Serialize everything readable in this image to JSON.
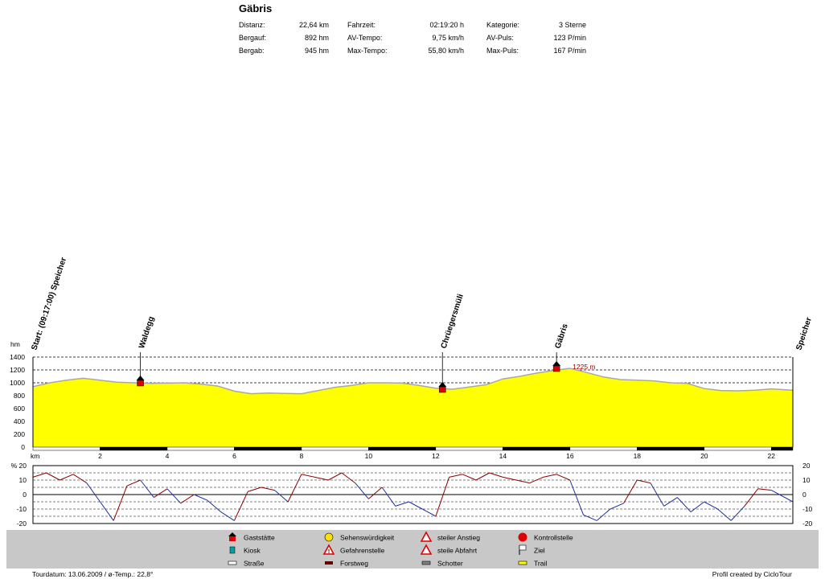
{
  "title": "Gäbris",
  "stats": {
    "col1": [
      {
        "label": "Distanz:",
        "value": "22,64 km"
      },
      {
        "label": "Bergauf:",
        "value": "892 hm"
      },
      {
        "label": "Bergab:",
        "value": "945 hm"
      }
    ],
    "col2": [
      {
        "label": "Fahrzeit:",
        "value": "02:19:20 h"
      },
      {
        "label": "AV-Tempo:",
        "value": "9,75 km/h"
      },
      {
        "label": "Max-Tempo:",
        "value": "55,80 km/h"
      }
    ],
    "col3": [
      {
        "label": "Kategorie:",
        "value": "3 Sterne"
      },
      {
        "label": "AV-Puls:",
        "value": "123 P/min"
      },
      {
        "label": "Max-Puls:",
        "value": "167 P/min"
      }
    ]
  },
  "chart_data": [
    {
      "type": "area",
      "ylabel": "hm",
      "xlabel": "km",
      "xlim": [
        0,
        22.64
      ],
      "ylim": [
        0,
        1400
      ],
      "yticks": [
        0,
        200,
        400,
        600,
        800,
        1000,
        1200,
        1400
      ],
      "xticks": [
        2,
        4,
        6,
        8,
        10,
        12,
        14,
        16,
        18,
        20,
        22
      ],
      "grid": "horizontal dashed",
      "fill_color": "#ffff00",
      "line_color": "#a8a8a8",
      "x": [
        0,
        0.5,
        1,
        1.5,
        2,
        2.5,
        3,
        3.5,
        4,
        4.5,
        5,
        5.5,
        6,
        6.5,
        7,
        7.5,
        8,
        8.5,
        9,
        9.5,
        10,
        10.5,
        11,
        11.5,
        12,
        12.5,
        13,
        13.5,
        14,
        14.5,
        15,
        15.5,
        16,
        16.5,
        17,
        17.5,
        18,
        18.5,
        19,
        19.5,
        20,
        20.5,
        21,
        21.5,
        22,
        22.64
      ],
      "y": [
        940,
        1000,
        1040,
        1070,
        1040,
        1010,
        1000,
        990,
        995,
        1000,
        980,
        950,
        870,
        830,
        840,
        835,
        830,
        880,
        930,
        960,
        1000,
        1000,
        995,
        960,
        915,
        900,
        935,
        970,
        1060,
        1100,
        1150,
        1190,
        1225,
        1160,
        1090,
        1050,
        1040,
        1030,
        1000,
        990,
        910,
        880,
        875,
        885,
        905,
        885
      ],
      "points": [
        {
          "label": "Start: (09:17:00) Speicher",
          "x": 0
        },
        {
          "label": "Waldegg",
          "x": 3.2,
          "elevation": 1000,
          "marker": "Gaststätte"
        },
        {
          "label": "Chrüegersmüli",
          "x": 12.2,
          "elevation": 900,
          "marker": "Gaststätte"
        },
        {
          "label": "Gäbris",
          "x": 15.6,
          "elevation": 1225,
          "marker": "Gaststätte",
          "annotation": "1225 m"
        },
        {
          "label": "Speicher",
          "x": 22.64
        }
      ]
    },
    {
      "type": "line",
      "ylabel": "%",
      "ylim": [
        -20,
        20
      ],
      "yticks": [
        -20,
        -10,
        0,
        10,
        20
      ],
      "grid": "horizontal dashed",
      "series": [
        {
          "color_up": "#8b0000",
          "color_down": "#2030a0",
          "x": [
            0,
            0.4,
            0.8,
            1.2,
            1.6,
            2.0,
            2.4,
            2.8,
            3.2,
            3.6,
            4.0,
            4.4,
            4.8,
            5.2,
            5.6,
            6.0,
            6.4,
            6.8,
            7.2,
            7.6,
            8.0,
            8.4,
            8.8,
            9.2,
            9.6,
            10.0,
            10.4,
            10.8,
            11.2,
            11.6,
            12.0,
            12.4,
            12.8,
            13.2,
            13.6,
            14.0,
            14.4,
            14.8,
            15.2,
            15.6,
            16.0,
            16.4,
            16.8,
            17.2,
            17.6,
            18.0,
            18.4,
            18.8,
            19.2,
            19.6,
            20.0,
            20.4,
            20.8,
            21.2,
            21.6,
            22.0,
            22.64
          ],
          "y": [
            12,
            15,
            10,
            14,
            8,
            -5,
            -18,
            6,
            10,
            -2,
            4,
            -6,
            0,
            -4,
            -12,
            -18,
            2,
            5,
            3,
            -5,
            14,
            12,
            10,
            15,
            8,
            -3,
            5,
            -8,
            -5,
            -10,
            -15,
            12,
            14,
            10,
            15,
            12,
            10,
            8,
            12,
            14,
            10,
            -14,
            -18,
            -10,
            -6,
            10,
            8,
            -8,
            -2,
            -12,
            -5,
            -10,
            -18,
            -8,
            4,
            3,
            -5
          ]
        }
      ]
    }
  ],
  "legend": [
    {
      "label": "Gaststätte",
      "icon": "gaststaette-icon"
    },
    {
      "label": "Kiosk",
      "icon": "kiosk-icon"
    },
    {
      "label": "Straße",
      "icon": "strasse-icon"
    },
    {
      "label": "Sehenswürdigkeit",
      "icon": "smiley-icon"
    },
    {
      "label": "Gefahrenstelle",
      "icon": "warning-icon"
    },
    {
      "label": "Forstweg",
      "icon": "forstweg-icon"
    },
    {
      "label": "steiler Anstieg",
      "icon": "steep-up-icon"
    },
    {
      "label": "steile Abfahrt",
      "icon": "steep-down-icon"
    },
    {
      "label": "Schotter",
      "icon": "schotter-icon"
    },
    {
      "label": "Kontrollstelle",
      "icon": "checkpoint-icon"
    },
    {
      "label": "Ziel",
      "icon": "finish-flag-icon"
    },
    {
      "label": "Trail",
      "icon": "trail-icon"
    }
  ],
  "footer": {
    "left": "Tourdatum: 13.06.2009  /  ø-Temp.: 22,8°",
    "right": "Profil created by CicloTour"
  }
}
